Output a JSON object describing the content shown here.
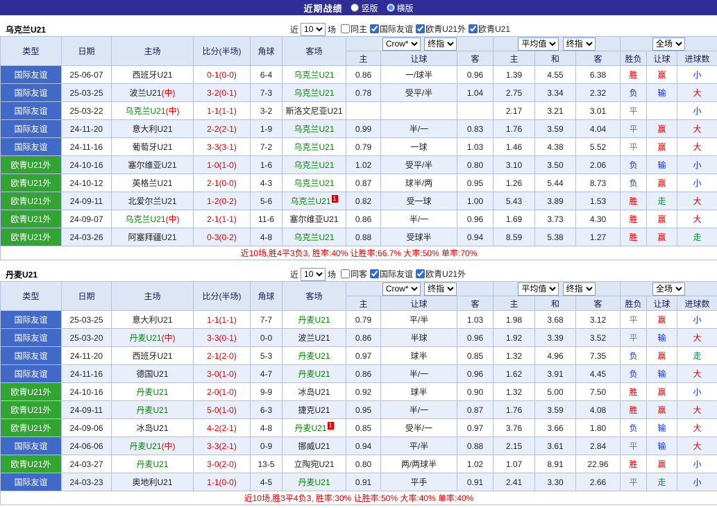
{
  "topbar": {
    "title": "近期战绩",
    "radios": [
      {
        "label": "竖版",
        "selected": false
      },
      {
        "label": "横版",
        "selected": true
      }
    ]
  },
  "labels": {
    "neutral": "(中)"
  },
  "headers": {
    "type": "类型",
    "date": "日期",
    "home": "主场",
    "score": "比分(半场)",
    "corner": "角球",
    "away": "客场",
    "group1": {
      "select1": "Crow*",
      "select2": "终指",
      "sub": [
        "主",
        "让球",
        "客"
      ]
    },
    "group2": {
      "select1": "平均值",
      "select2": "终指",
      "sub": [
        "主",
        "和",
        "客"
      ]
    },
    "group3": {
      "select1": "全场",
      "sub": [
        "胜负",
        "让球",
        "进球数"
      ]
    }
  },
  "colors": {
    "friendly_bg": "#4169c8",
    "euro_bg": "#33a433",
    "win": "#e10000",
    "lose": "#1133cc",
    "draw": "#777777",
    "push": "#009933",
    "score": "#e10000",
    "team_highlight": "#008800"
  },
  "tables": [
    {
      "team": "乌克兰U21",
      "filter": {
        "prefix": "近",
        "count": "10",
        "suffix": "场",
        "checkboxes": [
          {
            "label": "同主",
            "checked": false
          },
          {
            "label": "国际友谊",
            "checked": true
          },
          {
            "label": "欧青U21外",
            "checked": true
          },
          {
            "label": "欧青U21",
            "checked": true
          }
        ]
      },
      "rows": [
        {
          "league": "国际友谊",
          "league_kind": "friendly",
          "date": "25-06-07",
          "home": "西班牙U21",
          "home_hl": false,
          "home_neutral": false,
          "score": "0-1(0-0)",
          "corner": "6-4",
          "away": "乌克兰U21",
          "away_hl": true,
          "away_neutral": false,
          "away_badge": "",
          "odds": [
            "0.86",
            "一/球半",
            "0.96"
          ],
          "avg": [
            "1.39",
            "4.55",
            "6.38"
          ],
          "results": [
            {
              "t": "胜",
              "c": "red"
            },
            {
              "t": "赢",
              "c": "red"
            },
            {
              "t": "小",
              "c": "blue"
            }
          ]
        },
        {
          "league": "国际友谊",
          "league_kind": "friendly",
          "date": "25-03-25",
          "home": "波兰U21",
          "home_hl": false,
          "home_neutral": true,
          "score": "3-2(0-1)",
          "corner": "7-3",
          "away": "乌克兰U21",
          "away_hl": true,
          "away_neutral": false,
          "away_badge": "",
          "odds": [
            "0.78",
            "受平/半",
            "1.04"
          ],
          "avg": [
            "2.75",
            "3.34",
            "2.32"
          ],
          "results": [
            {
              "t": "负",
              "c": "blue"
            },
            {
              "t": "输",
              "c": "blue"
            },
            {
              "t": "大",
              "c": "red"
            }
          ]
        },
        {
          "league": "国际友谊",
          "league_kind": "friendly",
          "date": "25-03-22",
          "home": "乌克兰U21",
          "home_hl": true,
          "home_neutral": true,
          "score": "1-1(1-1)",
          "corner": "3-2",
          "away": "斯洛文尼亚U21",
          "away_hl": false,
          "away_neutral": false,
          "away_badge": "",
          "odds": [
            "",
            "",
            ""
          ],
          "avg": [
            "2.17",
            "3.21",
            "3.01"
          ],
          "results": [
            {
              "t": "平",
              "c": "gray"
            },
            {
              "t": "",
              "c": ""
            },
            {
              "t": "小",
              "c": "blue"
            }
          ]
        },
        {
          "league": "国际友谊",
          "league_kind": "friendly",
          "date": "24-11-20",
          "home": "意大利U21",
          "home_hl": false,
          "home_neutral": false,
          "score": "2-2(2-1)",
          "corner": "1-9",
          "away": "乌克兰U21",
          "away_hl": true,
          "away_neutral": false,
          "away_badge": "",
          "odds": [
            "0.99",
            "半/一",
            "0.83"
          ],
          "avg": [
            "1.76",
            "3.59",
            "4.04"
          ],
          "results": [
            {
              "t": "平",
              "c": "gray"
            },
            {
              "t": "赢",
              "c": "red"
            },
            {
              "t": "大",
              "c": "red"
            }
          ]
        },
        {
          "league": "国际友谊",
          "league_kind": "friendly",
          "date": "24-11-16",
          "home": "葡萄牙U21",
          "home_hl": false,
          "home_neutral": false,
          "score": "3-3(3-1)",
          "corner": "7-2",
          "away": "乌克兰U21",
          "away_hl": true,
          "away_neutral": false,
          "away_badge": "",
          "odds": [
            "0.79",
            "一球",
            "1.03"
          ],
          "avg": [
            "1.46",
            "4.38",
            "5.52"
          ],
          "results": [
            {
              "t": "平",
              "c": "gray"
            },
            {
              "t": "赢",
              "c": "red"
            },
            {
              "t": "大",
              "c": "red"
            }
          ]
        },
        {
          "league": "欧青U21外",
          "league_kind": "euro",
          "date": "24-10-16",
          "home": "塞尔维亚U21",
          "home_hl": false,
          "home_neutral": false,
          "score": "1-0(1-0)",
          "corner": "1-6",
          "away": "乌克兰U21",
          "away_hl": true,
          "away_neutral": false,
          "away_badge": "",
          "odds": [
            "1.02",
            "受平/半",
            "0.80"
          ],
          "avg": [
            "3.10",
            "3.50",
            "2.06"
          ],
          "results": [
            {
              "t": "负",
              "c": "blue"
            },
            {
              "t": "输",
              "c": "blue"
            },
            {
              "t": "小",
              "c": "blue"
            }
          ]
        },
        {
          "league": "欧青U21外",
          "league_kind": "euro",
          "date": "24-10-12",
          "home": "英格兰U21",
          "home_hl": false,
          "home_neutral": false,
          "score": "2-1(0-0)",
          "corner": "4-3",
          "away": "乌克兰U21",
          "away_hl": true,
          "away_neutral": false,
          "away_badge": "",
          "odds": [
            "0.87",
            "球半/两",
            "0.95"
          ],
          "avg": [
            "1.26",
            "5.44",
            "8.73"
          ],
          "results": [
            {
              "t": "负",
              "c": "blue"
            },
            {
              "t": "赢",
              "c": "red"
            },
            {
              "t": "小",
              "c": "blue"
            }
          ]
        },
        {
          "league": "欧青U21外",
          "league_kind": "euro",
          "date": "24-09-11",
          "home": "北爱尔兰U21",
          "home_hl": false,
          "home_neutral": false,
          "score": "1-2(0-2)",
          "corner": "5-6",
          "away": "乌克兰U21",
          "away_hl": true,
          "away_neutral": false,
          "away_badge": "1",
          "odds": [
            "0.82",
            "受一球",
            "1.00"
          ],
          "avg": [
            "5.43",
            "3.89",
            "1.53"
          ],
          "results": [
            {
              "t": "胜",
              "c": "red"
            },
            {
              "t": "走",
              "c": "green"
            },
            {
              "t": "大",
              "c": "red"
            }
          ]
        },
        {
          "league": "欧青U21外",
          "league_kind": "euro",
          "date": "24-09-07",
          "home": "乌克兰U21",
          "home_hl": true,
          "home_neutral": true,
          "score": "2-1(1-1)",
          "corner": "11-6",
          "away": "塞尔维亚U21",
          "away_hl": false,
          "away_neutral": false,
          "away_badge": "",
          "odds": [
            "0.86",
            "半/一",
            "0.96"
          ],
          "avg": [
            "1.69",
            "3.73",
            "4.30"
          ],
          "results": [
            {
              "t": "胜",
              "c": "red"
            },
            {
              "t": "赢",
              "c": "red"
            },
            {
              "t": "大",
              "c": "red"
            }
          ]
        },
        {
          "league": "欧青U21外",
          "league_kind": "euro",
          "date": "24-03-26",
          "home": "阿塞拜疆U21",
          "home_hl": false,
          "home_neutral": false,
          "score": "0-3(0-2)",
          "corner": "4-8",
          "away": "乌克兰U21",
          "away_hl": true,
          "away_neutral": false,
          "away_badge": "",
          "odds": [
            "0.88",
            "受球半",
            "0.94"
          ],
          "avg": [
            "8.59",
            "5.38",
            "1.27"
          ],
          "results": [
            {
              "t": "胜",
              "c": "red"
            },
            {
              "t": "赢",
              "c": "red"
            },
            {
              "t": "走",
              "c": "green"
            }
          ]
        }
      ],
      "summary": "近10场,胜4平3负3, 胜率:40% 让胜率:66.7% 大率:50% 单率:70%"
    },
    {
      "team": "丹麦U21",
      "filter": {
        "prefix": "近",
        "count": "10",
        "suffix": "场",
        "checkboxes": [
          {
            "label": "同客",
            "checked": false
          },
          {
            "label": "国际友谊",
            "checked": true
          },
          {
            "label": "欧青U21外",
            "checked": true
          }
        ]
      },
      "rows": [
        {
          "league": "国际友谊",
          "league_kind": "friendly",
          "date": "25-03-25",
          "home": "意大利U21",
          "home_hl": false,
          "home_neutral": false,
          "score": "1-1(1-1)",
          "corner": "7-7",
          "away": "丹麦U21",
          "away_hl": true,
          "away_neutral": false,
          "away_badge": "",
          "odds": [
            "0.79",
            "平/半",
            "1.03"
          ],
          "avg": [
            "1.98",
            "3.68",
            "3.12"
          ],
          "results": [
            {
              "t": "平",
              "c": "gray"
            },
            {
              "t": "赢",
              "c": "red"
            },
            {
              "t": "小",
              "c": "blue"
            }
          ]
        },
        {
          "league": "国际友谊",
          "league_kind": "friendly",
          "date": "25-03-20",
          "home": "丹麦U21",
          "home_hl": true,
          "home_neutral": true,
          "score": "3-3(0-1)",
          "corner": "0-0",
          "away": "波兰U21",
          "away_hl": false,
          "away_neutral": false,
          "away_badge": "",
          "odds": [
            "0.86",
            "半球",
            "0.96"
          ],
          "avg": [
            "1.92",
            "3.39",
            "3.52"
          ],
          "results": [
            {
              "t": "平",
              "c": "gray"
            },
            {
              "t": "输",
              "c": "blue"
            },
            {
              "t": "大",
              "c": "red"
            }
          ]
        },
        {
          "league": "国际友谊",
          "league_kind": "friendly",
          "date": "24-11-20",
          "home": "西班牙U21",
          "home_hl": false,
          "home_neutral": false,
          "score": "2-1(2-0)",
          "corner": "5-3",
          "away": "丹麦U21",
          "away_hl": true,
          "away_neutral": false,
          "away_badge": "",
          "odds": [
            "0.97",
            "球半",
            "0.85"
          ],
          "avg": [
            "1.32",
            "4.96",
            "7.35"
          ],
          "results": [
            {
              "t": "负",
              "c": "blue"
            },
            {
              "t": "赢",
              "c": "red"
            },
            {
              "t": "走",
              "c": "green"
            }
          ]
        },
        {
          "league": "国际友谊",
          "league_kind": "friendly",
          "date": "24-11-16",
          "home": "德国U21",
          "home_hl": false,
          "home_neutral": false,
          "score": "3-0(1-0)",
          "corner": "4-7",
          "away": "丹麦U21",
          "away_hl": true,
          "away_neutral": false,
          "away_badge": "",
          "odds": [
            "0.86",
            "半/一",
            "0.96"
          ],
          "avg": [
            "1.62",
            "3.91",
            "4.45"
          ],
          "results": [
            {
              "t": "负",
              "c": "blue"
            },
            {
              "t": "输",
              "c": "blue"
            },
            {
              "t": "大",
              "c": "red"
            }
          ]
        },
        {
          "league": "欧青U21外",
          "league_kind": "euro",
          "date": "24-10-16",
          "home": "丹麦U21",
          "home_hl": true,
          "home_neutral": false,
          "score": "2-0(1-0)",
          "corner": "9-9",
          "away": "冰岛U21",
          "away_hl": false,
          "away_neutral": false,
          "away_badge": "",
          "odds": [
            "0.92",
            "球半",
            "0.90"
          ],
          "avg": [
            "1.32",
            "5.00",
            "7.50"
          ],
          "results": [
            {
              "t": "胜",
              "c": "red"
            },
            {
              "t": "赢",
              "c": "red"
            },
            {
              "t": "小",
              "c": "blue"
            }
          ]
        },
        {
          "league": "欧青U21外",
          "league_kind": "euro",
          "date": "24-09-11",
          "home": "丹麦U21",
          "home_hl": true,
          "home_neutral": false,
          "score": "5-0(1-0)",
          "corner": "6-3",
          "away": "捷克U21",
          "away_hl": false,
          "away_neutral": false,
          "away_badge": "",
          "odds": [
            "0.95",
            "半/一",
            "0.87"
          ],
          "avg": [
            "1.76",
            "3.59",
            "4.08"
          ],
          "results": [
            {
              "t": "胜",
              "c": "red"
            },
            {
              "t": "赢",
              "c": "red"
            },
            {
              "t": "大",
              "c": "red"
            }
          ]
        },
        {
          "league": "欧青U21外",
          "league_kind": "euro",
          "date": "24-09-06",
          "home": "冰岛U21",
          "home_hl": false,
          "home_neutral": false,
          "score": "4-2(2-1)",
          "corner": "4-8",
          "away": "丹麦U21",
          "away_hl": true,
          "away_neutral": false,
          "away_badge": "1",
          "odds": [
            "0.85",
            "受半/一",
            "0.97"
          ],
          "avg": [
            "3.76",
            "3.66",
            "1.80"
          ],
          "results": [
            {
              "t": "负",
              "c": "blue"
            },
            {
              "t": "输",
              "c": "blue"
            },
            {
              "t": "大",
              "c": "red"
            }
          ]
        },
        {
          "league": "国际友谊",
          "league_kind": "friendly",
          "date": "24-06-06",
          "home": "丹麦U21",
          "home_hl": true,
          "home_neutral": true,
          "score": "3-3(2-1)",
          "corner": "0-9",
          "away": "挪威U21",
          "away_hl": false,
          "away_neutral": false,
          "away_badge": "",
          "odds": [
            "0.94",
            "平/半",
            "0.88"
          ],
          "avg": [
            "2.15",
            "3.61",
            "2.84"
          ],
          "results": [
            {
              "t": "平",
              "c": "gray"
            },
            {
              "t": "输",
              "c": "blue"
            },
            {
              "t": "大",
              "c": "red"
            }
          ]
        },
        {
          "league": "欧青U21外",
          "league_kind": "euro",
          "date": "24-03-27",
          "home": "丹麦U21",
          "home_hl": true,
          "home_neutral": false,
          "score": "3-0(2-0)",
          "corner": "13-5",
          "away": "立陶宛U21",
          "away_hl": false,
          "away_neutral": false,
          "away_badge": "",
          "odds": [
            "0.80",
            "两/两球半",
            "1.02"
          ],
          "avg": [
            "1.07",
            "8.91",
            "22.96"
          ],
          "results": [
            {
              "t": "胜",
              "c": "red"
            },
            {
              "t": "赢",
              "c": "red"
            },
            {
              "t": "小",
              "c": "blue"
            }
          ]
        },
        {
          "league": "国际友谊",
          "league_kind": "friendly",
          "date": "24-03-23",
          "home": "奥地利U21",
          "home_hl": false,
          "home_neutral": false,
          "score": "1-1(0-0)",
          "corner": "4-5",
          "away": "丹麦U21",
          "away_hl": true,
          "away_neutral": false,
          "away_badge": "",
          "odds": [
            "0.91",
            "平手",
            "0.91"
          ],
          "avg": [
            "2.41",
            "3.30",
            "2.66"
          ],
          "results": [
            {
              "t": "平",
              "c": "gray"
            },
            {
              "t": "走",
              "c": "green"
            },
            {
              "t": "小",
              "c": "blue"
            }
          ]
        }
      ],
      "summary": "近10场,胜3平4负3, 胜率:30% 让胜率:50% 大率:40% 单率:40%"
    }
  ]
}
